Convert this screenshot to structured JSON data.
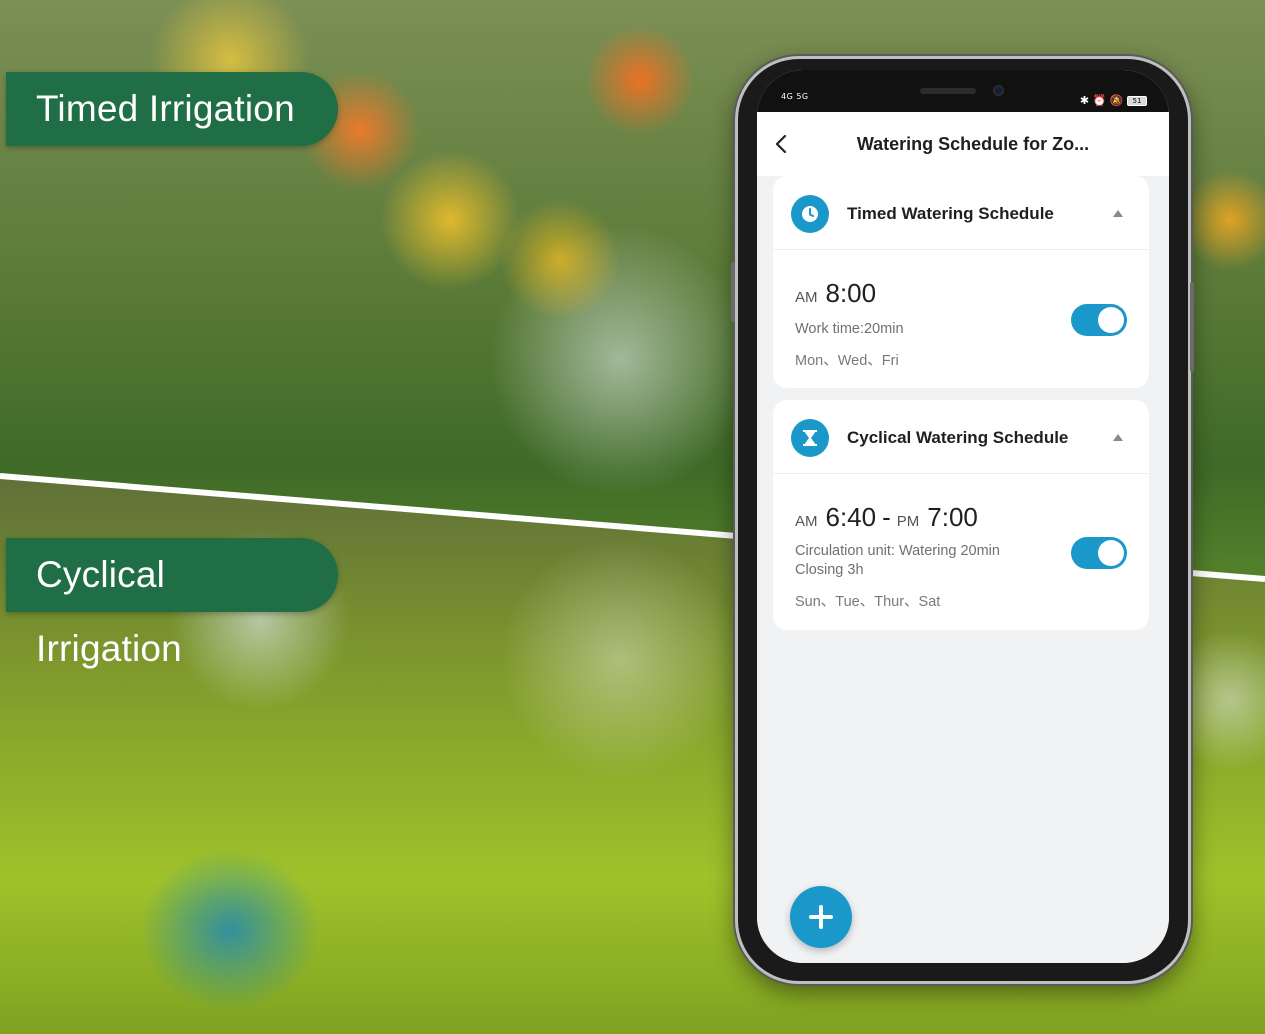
{
  "labels": {
    "timed": "Timed Irrigation",
    "cyclical": "Cyclical Irrigation"
  },
  "status_bar": {
    "network": "4G 5G",
    "battery": "51"
  },
  "nav": {
    "back_icon": "chevron-left-icon",
    "title": "Watering Schedule for Zo..."
  },
  "timed_card": {
    "icon": "clock-icon",
    "title": "Timed Watering Schedule",
    "time_ampm": "AM",
    "time": "8:00",
    "detail": "Work time:20min",
    "days": "Mon、Wed、Fri",
    "enabled": true
  },
  "cyclical_card": {
    "icon": "hourglass-icon",
    "title": "Cyclical Watering Schedule",
    "start_ampm": "AM",
    "start_time": "6:40",
    "dash": "-",
    "end_ampm": "PM",
    "end_time": "7:00",
    "detail_line1": "Circulation unit: Watering 20min",
    "detail_line2": "Closing 3h",
    "days": "Sun、Tue、Thur、Sat",
    "enabled": true
  },
  "fab": {
    "icon": "plus-icon"
  },
  "colors": {
    "accent": "#1a98c9",
    "label_green": "#1f6e45"
  }
}
